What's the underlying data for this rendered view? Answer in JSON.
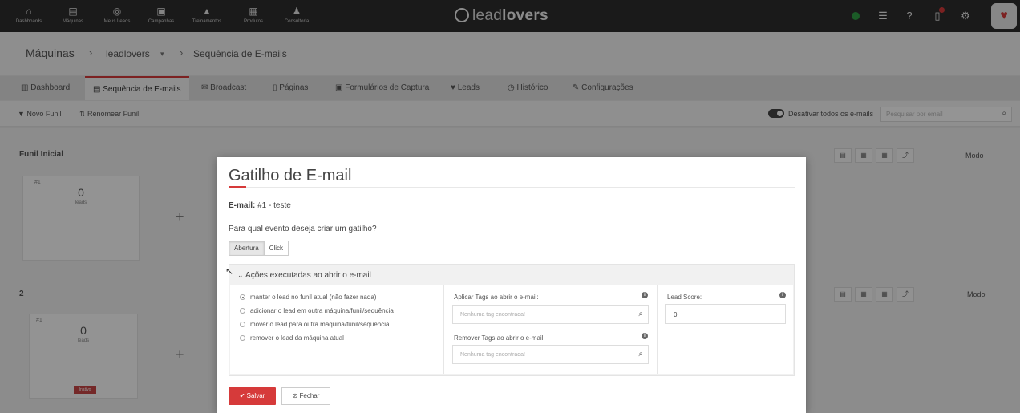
{
  "topbar": {
    "nav": [
      {
        "label": "Dashboards",
        "icon": "home-icon"
      },
      {
        "label": "Máquinas",
        "icon": "machine-icon"
      },
      {
        "label": "Meus Leads",
        "icon": "target-icon"
      },
      {
        "label": "Campanhas",
        "icon": "chat-icon"
      },
      {
        "label": "Treinamentos",
        "icon": "graduation-icon"
      },
      {
        "label": "Produtos",
        "icon": "briefcase-icon"
      },
      {
        "label": "Consultoria",
        "icon": "person-icon"
      }
    ],
    "logo": {
      "light": "lead",
      "bold": "lovers"
    }
  },
  "breadcrumb": {
    "root": "Máquinas",
    "machine": "leadlovers",
    "current": "Sequência de E-mails"
  },
  "tabs": [
    "Dashboard",
    "Sequência de E-mails",
    "Broadcast",
    "Páginas",
    "Formulários de Captura",
    "Leads",
    "Histórico",
    "Configurações"
  ],
  "toolbar": {
    "new_funnel": "Novo Funil",
    "rename_funnel": "Renomear Funil",
    "toggle_label": "Desativar todos os e-mails",
    "search_placeholder": "Pesquisar por email"
  },
  "funnels": [
    {
      "title": "Funil Inicial",
      "card_title": "#1",
      "count": "0",
      "sub": "leads",
      "add_button": "+",
      "view_label": "Modo"
    },
    {
      "title": "2",
      "card_title": "#1",
      "count": "0",
      "sub": "leads",
      "add_button": "+",
      "view_label": "Modo",
      "badge": "Inativo"
    }
  ],
  "modal": {
    "title": "Gatilho de E-mail",
    "email_label": "E-mail:",
    "email_value": "#1 - teste",
    "question": "Para qual evento deseja criar um gatilho?",
    "event_options": [
      "Abertura",
      "Click"
    ],
    "selected_event": "Abertura",
    "actions_header": "Ações executadas ao abrir o e-mail",
    "radio_options": [
      "manter o lead no funil atual (não fazer nada)",
      "adicionar o lead em outra máquina/funil/sequência",
      "mover o lead para outra máquina/funil/sequência",
      "remover o lead da máquina atual"
    ],
    "selected_radio": 0,
    "apply_tags_label": "Aplicar Tags ao abrir o e-mail:",
    "apply_tags_placeholder": "Nenhuma tag encontrada!",
    "remove_tags_label": "Remover Tags ao abrir o e-mail:",
    "remove_tags_placeholder": "Nenhuma tag encontrada!",
    "lead_score_label": "Lead Score:",
    "lead_score_value": "0",
    "save_button": "Salvar",
    "close_button": "Fechar"
  },
  "colors": {
    "accent": "#d63a3a",
    "topbar": "#2e2e2e",
    "online": "#2f9e44"
  }
}
